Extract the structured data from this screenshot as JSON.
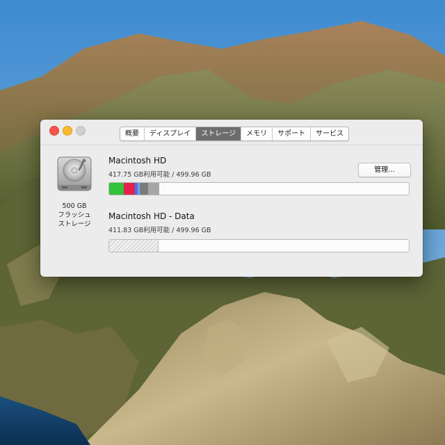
{
  "window": {
    "tabs": [
      {
        "label": "概要",
        "active": false
      },
      {
        "label": "ディスプレイ",
        "active": false
      },
      {
        "label": "ストレージ",
        "active": true
      },
      {
        "label": "メモリ",
        "active": false
      },
      {
        "label": "サポート",
        "active": false
      },
      {
        "label": "サービス",
        "active": false
      }
    ],
    "disk": {
      "icon": "hard-drive-icon",
      "capacity": "500 GB",
      "type_line1": "フラッシュ",
      "type_line2": "ストレージ"
    },
    "volumes": [
      {
        "name": "Macintosh HD",
        "info": "417.75 GB利用可能 / 499.96 GB",
        "manage_label": "管理...",
        "usage_segments": [
          {
            "category": "apps",
            "color": "#34c23a",
            "fraction": 0.048
          },
          {
            "category": "documents",
            "color": "#e8204f",
            "fraction": 0.036
          },
          {
            "category": "music",
            "color": "#2d7df0",
            "fraction": 0.006
          },
          {
            "category": "other-purple",
            "color": "#a060e0",
            "fraction": 0.005
          },
          {
            "category": "other-cyan",
            "color": "#40c8e8",
            "fraction": 0.004
          },
          {
            "category": "system",
            "color": "#7b7b7b",
            "fraction": 0.028
          },
          {
            "category": "other-volumes",
            "color": "#a6a6a6",
            "fraction": 0.036
          }
        ]
      },
      {
        "name": "Macintosh HD - Data",
        "info": "411.83 GB利用可能 / 499.96 GB",
        "usage_segments": [
          {
            "category": "used-hatched",
            "fraction": 0.163
          }
        ]
      }
    ]
  }
}
